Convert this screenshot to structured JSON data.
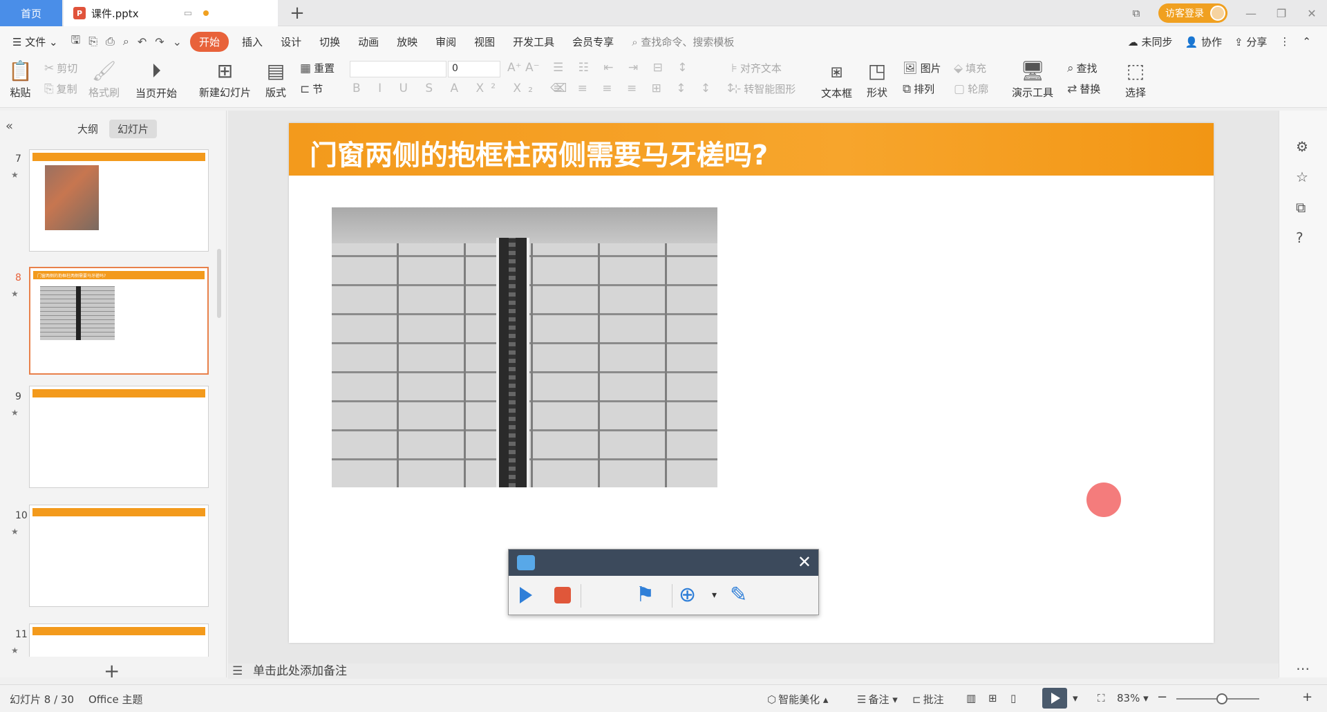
{
  "titlebar": {
    "home_tab": "首页",
    "doc_tab": "课件.pptx",
    "doc_icon_letter": "P",
    "login": "访客登录",
    "controls": [
      "—",
      "❐",
      "✕"
    ]
  },
  "menubar": {
    "file": "文件",
    "tabs": [
      "开始",
      "插入",
      "设计",
      "切换",
      "动画",
      "放映",
      "审阅",
      "视图",
      "开发工具",
      "会员专享"
    ],
    "active_tab": "开始",
    "search": "查找命令、搜索模板",
    "right": [
      "未同步",
      "协作",
      "分享"
    ]
  },
  "ribbon": {
    "paste": "粘贴",
    "cut": "剪切",
    "copy": "复制",
    "format_painter": "格式刷",
    "from_current": "当页开始",
    "new_slide": "新建幻灯片",
    "layout": "版式",
    "reset": "重置",
    "section": "节",
    "font_size": "0",
    "align_text": "对齐文本",
    "smart_art": "转智能图形",
    "textbox": "文本框",
    "shape": "形状",
    "picture": "图片",
    "fill": "填充",
    "arrange": "排列",
    "outline": "轮廓",
    "presenter_tools": "演示工具",
    "find": "查找",
    "replace": "替换",
    "select": "选择"
  },
  "leftpane": {
    "tab_outline": "大纲",
    "tab_slides": "幻灯片",
    "slides": [
      {
        "num": "7",
        "title": ""
      },
      {
        "num": "8",
        "title": "门窗两侧的抱框柱两侧需要马牙槎吗?"
      },
      {
        "num": "9",
        "title": ""
      },
      {
        "num": "10",
        "title": ""
      },
      {
        "num": "11",
        "title": ""
      }
    ],
    "add_label": "+"
  },
  "slide": {
    "title": "门窗两侧的抱框柱两侧需要马牙槎吗?"
  },
  "notes": {
    "placeholder": "单击此处添加备注"
  },
  "statusbar": {
    "slide_counter": "幻灯片 8 / 30",
    "theme": "Office 主题",
    "beautify": "智能美化",
    "notes": "备注",
    "comments": "批注",
    "zoom": "83%",
    "minus": "−",
    "plus": "+"
  },
  "colors": {
    "accent": "#e8623a",
    "title_band": "#f39a1c",
    "home_tab": "#4a8ee8",
    "login": "#f0a020"
  }
}
